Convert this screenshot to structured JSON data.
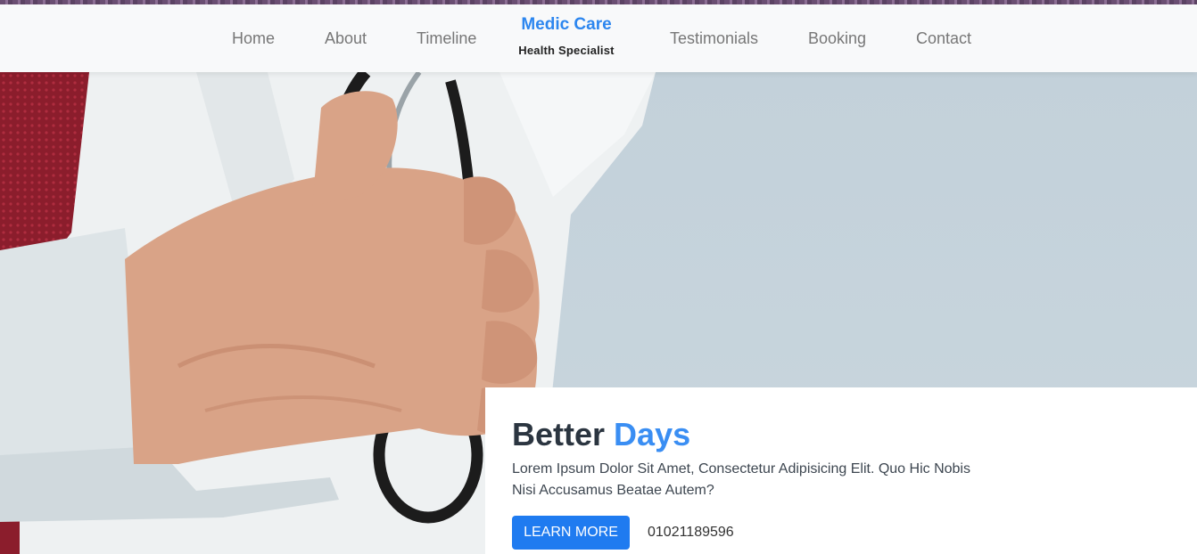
{
  "navbar": {
    "links_left": [
      "Home",
      "About",
      "Timeline"
    ],
    "brand": {
      "title": "Medic Care",
      "subtitle": "Health Specialist"
    },
    "links_right": [
      "Testimonials",
      "Booking",
      "Contact"
    ]
  },
  "hero": {
    "heading_main": "Better",
    "heading_accent": "Days",
    "description": "Lorem Ipsum Dolor Sit Amet, Consectetur Adipisicing Elit. Quo Hic Nobis Nisi Accusamus Beatae Autem?",
    "button_label": "LEARN MORE",
    "phone": "01021189596"
  },
  "colors": {
    "accent": "#3a8ef3",
    "button": "#1f7bf0",
    "hero_background": "#c3d1da",
    "navbar_background": "#f8f9fa"
  },
  "icons": [
    "doctor-hero-photo"
  ]
}
